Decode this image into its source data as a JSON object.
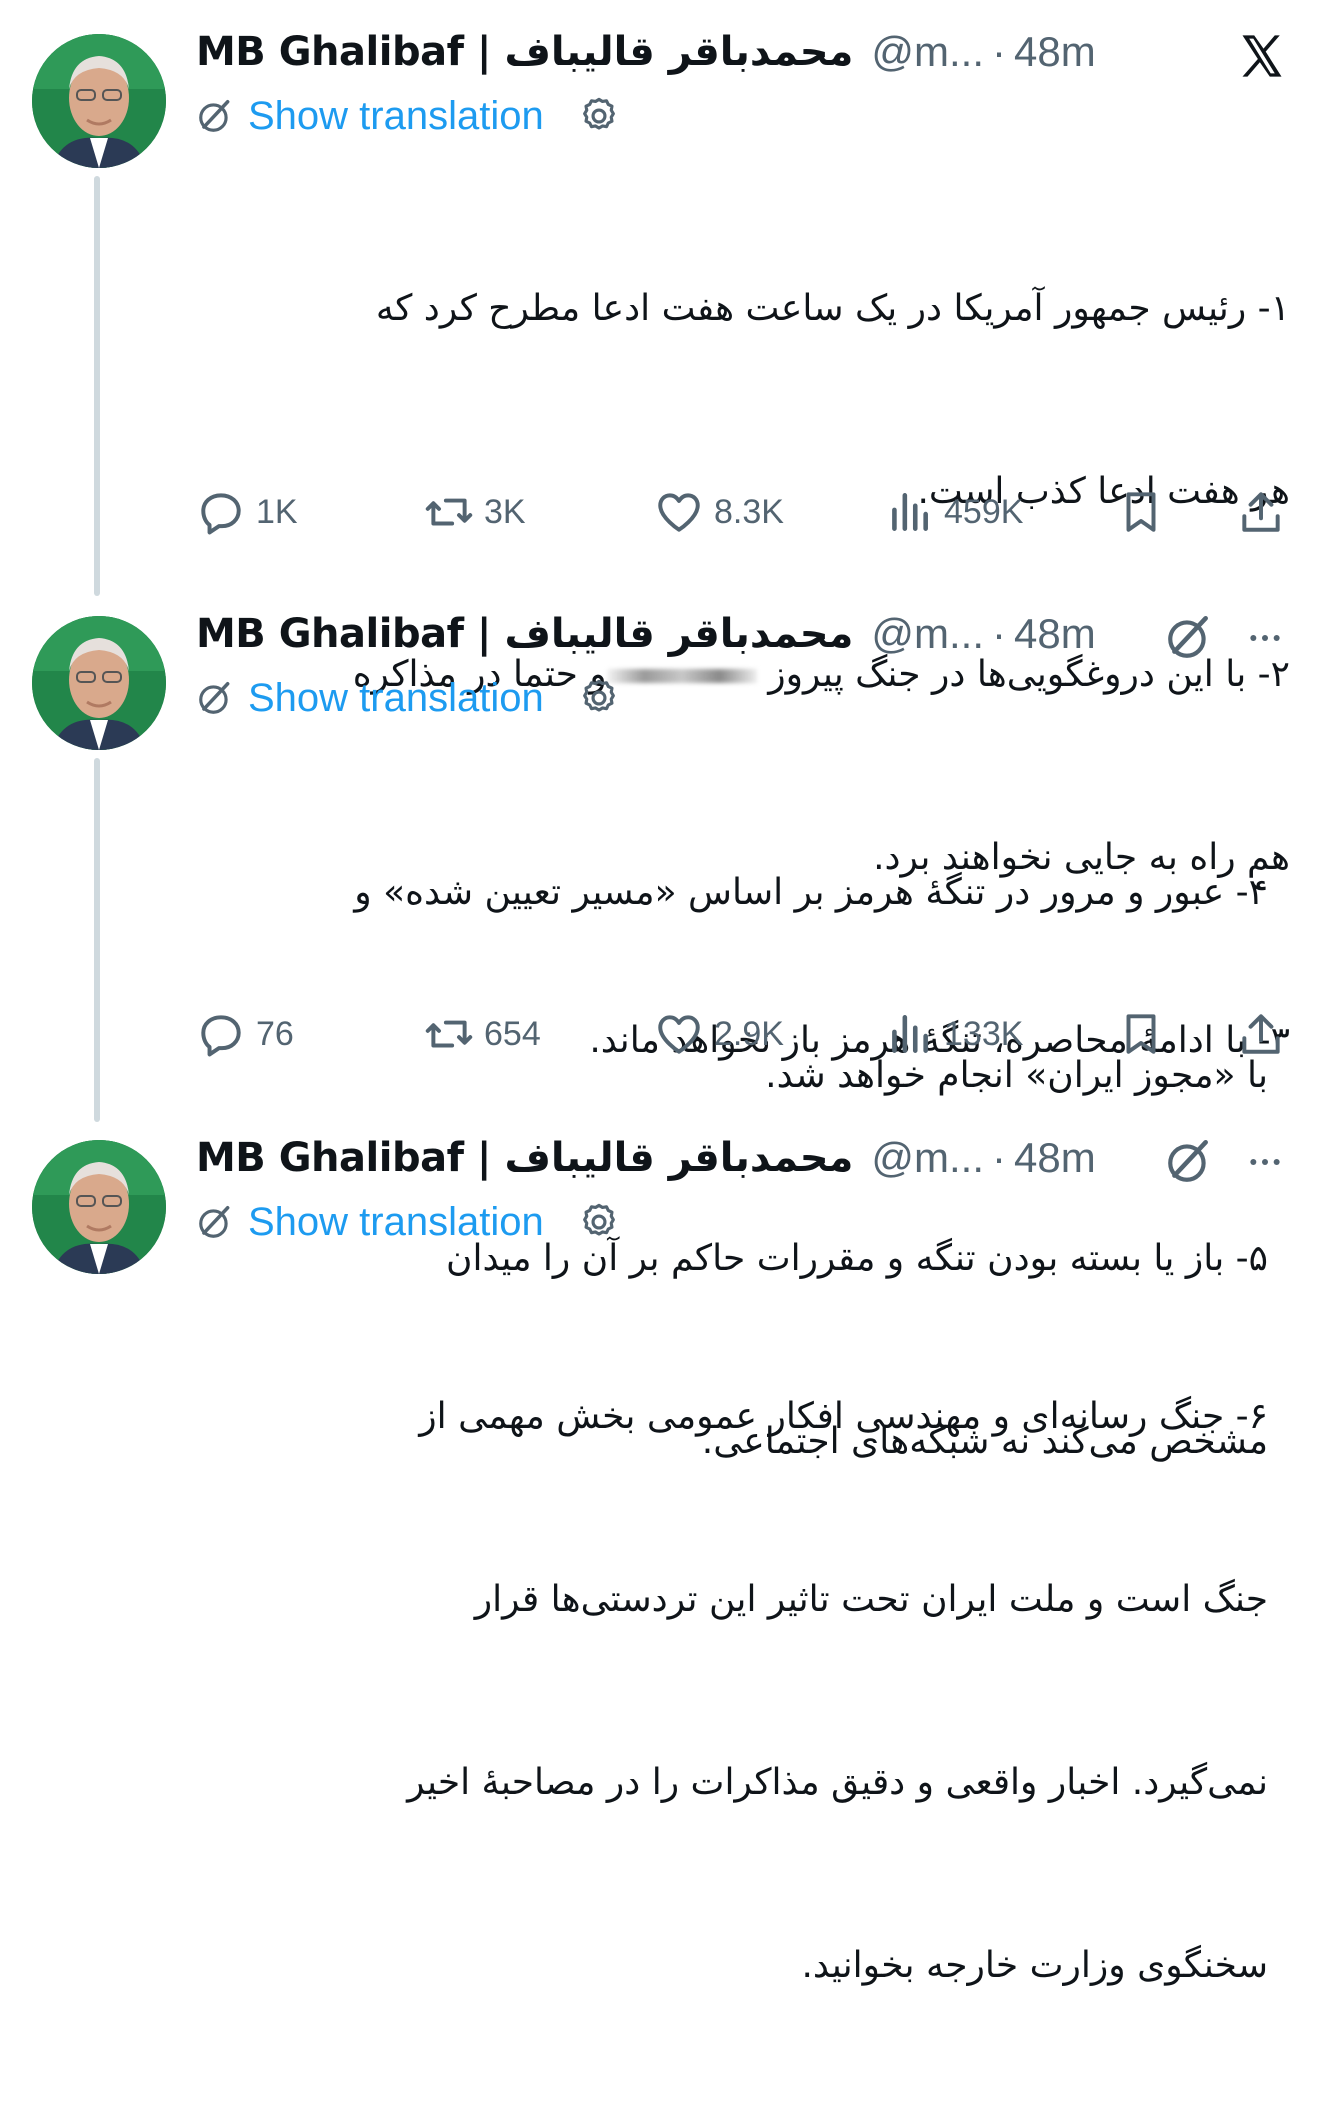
{
  "colors": {
    "accent": "#1d9bf0",
    "muted": "#536471",
    "text": "#0f1419",
    "thread_line": "#cfd9de",
    "avatar_bg": "#1e7a3b"
  },
  "tweets": [
    {
      "name": "MB Ghalibaf | محمدباقر قالیباف",
      "handle": "@m...",
      "dot": "·",
      "time": "48m",
      "translation": "Show translation",
      "text_lines": [
        "۱- رئیس جمهور آمریکا در یک ساعت هفت ادعا مطرح کرد که",
        "هر هفت ادعا کذب است.",
        "۲- با این دروغگویی‌ها در جنگ پیروز",
        "و حتما در مذاکره",
        "هم راه به جایی نخواهند برد.",
        "۳- با ادامهٔ محاصره، تنگهٔ هرمز باز نخواهد ماند."
      ],
      "replies": "1K",
      "reposts": "3K",
      "likes": "8.3K",
      "views": "459K"
    },
    {
      "name": "MB Ghalibaf | محمدباقر قالیباف",
      "handle": "@m...",
      "dot": "·",
      "time": "48m",
      "translation": "Show translation",
      "text_lines": [
        "۴- عبور و مرور در تنگهٔ هرمز بر اساس «مسیر تعیین شده» و",
        "با «مجوز ایران» انجام خواهد شد.",
        "۵- باز یا بسته بودن تنگه و مقررات حاکم بر آن را میدان",
        "مشخص می‌کند نه شبکه‌های اجتماعی."
      ],
      "replies": "76",
      "reposts": "654",
      "likes": "2.9K",
      "views": "133K"
    },
    {
      "name": "MB Ghalibaf | محمدباقر قالیباف",
      "handle": "@m...",
      "dot": "·",
      "time": "48m",
      "translation": "Show translation",
      "text_lines": [
        "۶- جنگ رسانه‌ای و مهندسی افکار عمومی بخش مهمی از",
        "جنگ است و ملت ایران تحت تاثیر این تردستی‌ها قرار",
        "نمی‌گیرد. اخبار واقعی و دقیق مذاکرات را در مصاحبهٔ اخیر",
        "سخنگوی وزارت خارجه بخوانید."
      ]
    }
  ]
}
